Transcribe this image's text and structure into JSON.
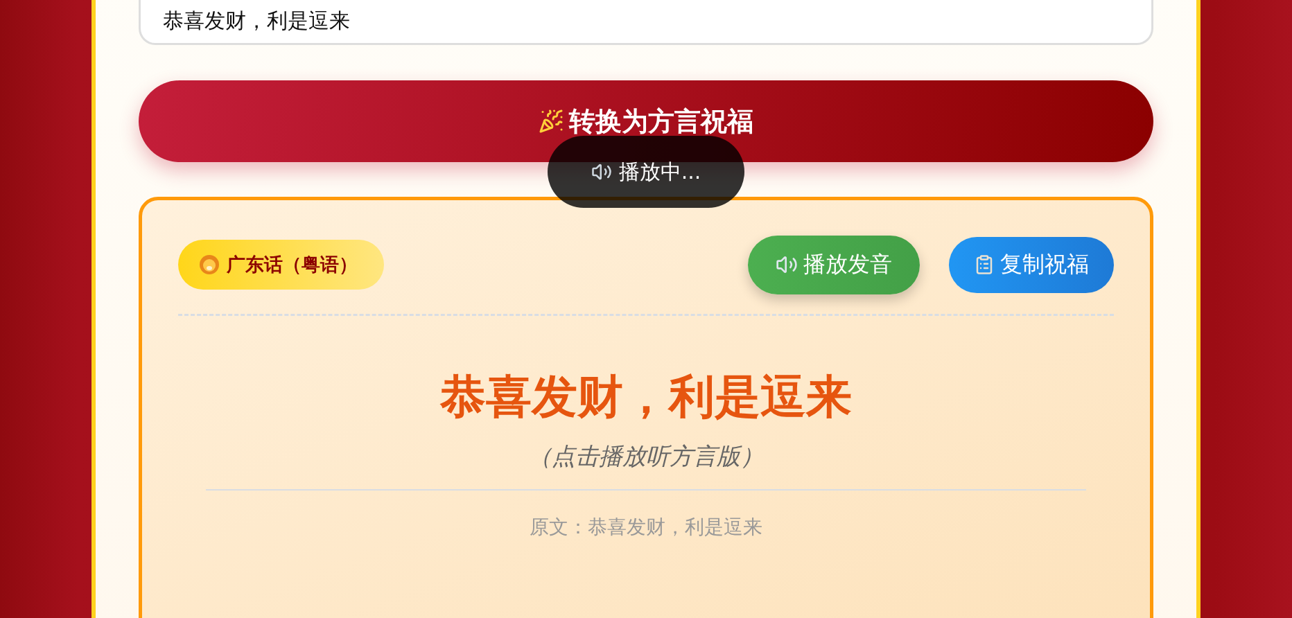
{
  "input": {
    "value": "恭喜发财，利是逗来"
  },
  "convert_button": {
    "label": "转换为方言祝福"
  },
  "toast": {
    "text": "播放中..."
  },
  "result": {
    "dialect": "广东话（粤语）",
    "buttons": [
      {
        "kind": "play",
        "label": "播放发音"
      },
      {
        "kind": "copy",
        "label": "复制祝福"
      }
    ],
    "text": "恭喜发财，利是逗来",
    "hint": "（点击播放听方言版）",
    "original": "原文：恭喜发财，利是逗来"
  }
}
